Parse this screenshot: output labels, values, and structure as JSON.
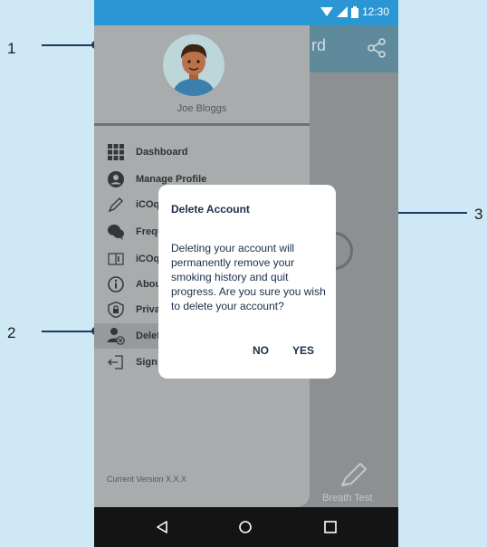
{
  "callouts": [
    "1",
    "2",
    "3"
  ],
  "status_bar": {
    "time": "12:30",
    "icons": [
      "wifi-icon",
      "signal-icon",
      "battery-icon"
    ]
  },
  "app_bar": {
    "title_fragment": "rd",
    "share_icon": "share-icon"
  },
  "drawer": {
    "user_name": "Joe Bloggs",
    "items": [
      {
        "label": "Dashboard",
        "icon": "grid-icon"
      },
      {
        "label": "Manage Profile",
        "icon": "user-circle-icon"
      },
      {
        "label": "iCOq",
        "icon": "pencil-icon"
      },
      {
        "label": "Frequ",
        "icon": "chat-icon"
      },
      {
        "label": "iCOq",
        "icon": "book-icon"
      },
      {
        "label": "Abou",
        "icon": "info-icon"
      },
      {
        "label": "Priva",
        "icon": "lock-icon"
      },
      {
        "label": "Delet",
        "icon": "user-delete-icon"
      },
      {
        "label": "Sign",
        "icon": "sign-out-icon"
      }
    ],
    "active_index": 7,
    "version": "Current Version X.X.X"
  },
  "background": {
    "breath_test_label": "Breath Test"
  },
  "dialog": {
    "title": "Delete Account",
    "message": "Deleting your account will permanently remove your smoking history and quit progress. Are you sure you wish to delete your account?",
    "no_label": "NO",
    "yes_label": "YES"
  },
  "nav_bar": {
    "icons": [
      "back-icon",
      "home-icon",
      "recents-icon"
    ]
  },
  "colors": {
    "accent": "#2a96d3",
    "callout": "#1f3a5c",
    "dialog_text": "#1b2f4a"
  }
}
